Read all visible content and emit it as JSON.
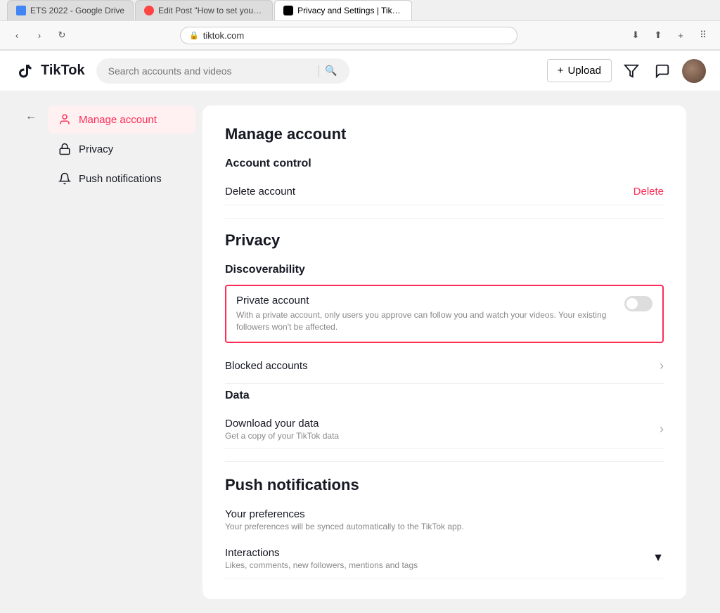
{
  "browser": {
    "address": "tiktok.com",
    "lock_icon": "🔒",
    "back_btn": "‹",
    "forward_btn": "›",
    "reload_icon": "↻",
    "tabs": [
      {
        "id": "google",
        "label": "ETS 2022 - Google Drive",
        "favicon_color": "#4285f4",
        "active": false
      },
      {
        "id": "snaptik",
        "label": "Edit Post \"How to set your account as a private one?\" • Snaptik| Snaptik app |...",
        "favicon_color": "#ff4444",
        "active": false
      },
      {
        "id": "tiktok",
        "label": "Privacy and Settings | TikTok",
        "favicon_color": "#010101",
        "active": true
      }
    ]
  },
  "header": {
    "logo_text": "TikTok",
    "search_placeholder": "Search accounts and videos",
    "upload_label": "Upload"
  },
  "sidebar": {
    "back_tooltip": "Back",
    "items": [
      {
        "id": "manage-account",
        "label": "Manage account",
        "icon": "👤",
        "active": true
      },
      {
        "id": "privacy",
        "label": "Privacy",
        "icon": "🔒",
        "active": false
      },
      {
        "id": "push-notifications",
        "label": "Push notifications",
        "icon": "🔔",
        "active": false
      }
    ]
  },
  "main": {
    "page_title": "Manage account",
    "account_control": {
      "title": "Account control",
      "delete_row": {
        "label": "Delete account",
        "action": "Delete"
      }
    },
    "privacy": {
      "title": "Privacy",
      "discoverability": {
        "title": "Discoverability",
        "private_account": {
          "title": "Private account",
          "description": "With a private account, only users you approve can follow you and watch your videos. Your existing followers won't be affected.",
          "toggle_on": false
        }
      },
      "blocked_accounts": {
        "label": "Blocked accounts"
      },
      "data": {
        "title": "Data",
        "download": {
          "title": "Download your data",
          "description": "Get a copy of your TikTok data"
        }
      }
    },
    "push_notifications": {
      "title": "Push notifications",
      "preferences": {
        "title": "Your preferences",
        "description": "Your preferences will be synced automatically to the TikTok app."
      },
      "interactions": {
        "title": "Interactions",
        "description": "Likes, comments, new followers, mentions and tags"
      }
    }
  }
}
